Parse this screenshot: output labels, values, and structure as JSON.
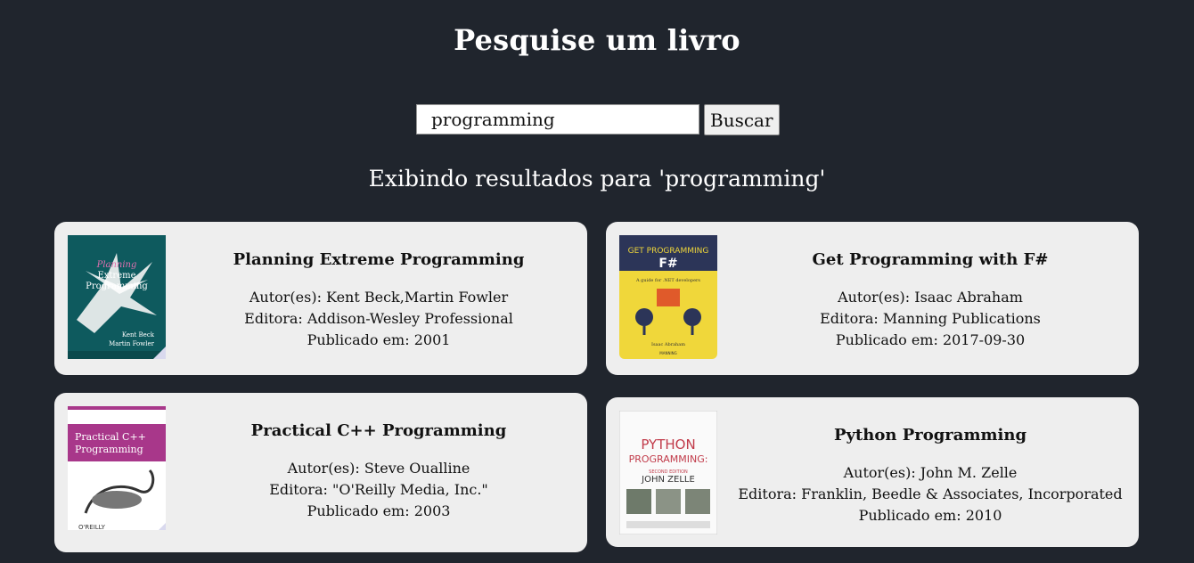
{
  "header": {
    "title": "Pesquise um livro"
  },
  "search": {
    "value": "programming",
    "button_label": "Buscar"
  },
  "results": {
    "label": "Exibindo resultados para 'programming'"
  },
  "books": [
    {
      "title": "Planning Extreme Programming",
      "authors": "Autor(es): Kent Beck,Martin Fowler",
      "publisher": "Editora: Addison-Wesley Professional",
      "published": "Publicado em: 2001",
      "cover": {
        "title": "Planning Extreme Programming",
        "authors": "Kent Beck, Martin Fowler"
      }
    },
    {
      "title": "Get Programming with F#",
      "authors": "Autor(es): Isaac Abraham",
      "publisher": "Editora: Manning Publications",
      "published": "Publicado em: 2017-09-30",
      "cover": {
        "title": "GET PROGRAMMING with F#",
        "authors": "Isaac Abraham"
      }
    },
    {
      "title": "Practical C++ Programming",
      "authors": "Autor(es): Steve Oualline",
      "publisher": "Editora: \"O'Reilly Media, Inc.\"",
      "published": "Publicado em: 2003",
      "cover": {
        "title": "Practical C++ Programming",
        "publisher": "O'REILLY"
      }
    },
    {
      "title": "Python Programming",
      "authors": "Autor(es): John M. Zelle",
      "publisher": "Editora: Franklin, Beedle & Associates, Incorporated",
      "published": "Publicado em: 2010",
      "cover": {
        "title": "PYTHON PROGRAMMING:",
        "edition": "SECOND EDITION",
        "author": "JOHN ZELLE"
      }
    }
  ]
}
